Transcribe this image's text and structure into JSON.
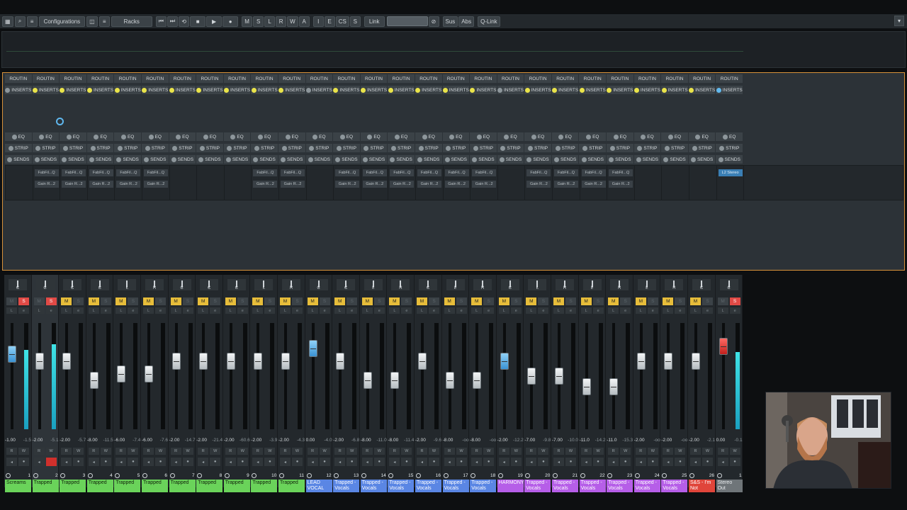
{
  "toolbar": {
    "configurations_label": "Configurations",
    "racks_label": "Racks",
    "transport_m": "M",
    "transport_s": "S",
    "transport_l": "L",
    "transport_r": "R",
    "transport_w": "W",
    "transport_a": "A",
    "transport_i": "I",
    "transport_e": "E",
    "transport_cs": "CS",
    "transport_s2": "S",
    "link_label": "Link",
    "sus_label": "Sus",
    "abs_label": "Abs",
    "qlink_label": "Q-Link"
  },
  "rack": {
    "routing_label": "ROUTIN",
    "inserts_label": "INSERTS",
    "eq_label": "EQ",
    "strip_label": "STRIP",
    "sends_label": "SENDS",
    "slot_fabfilter": "FabFil...Q",
    "slot_gain": "Gain R...2",
    "output_slot": "L2 Stereo"
  },
  "channels": [
    {
      "num": "1",
      "name": "Screams",
      "pan": "C",
      "m": false,
      "s": true,
      "fader": "-1.00",
      "peak": "-1.5",
      "color": "green",
      "meter": 0.75,
      "cap": 0.25,
      "capColor": "blue"
    },
    {
      "num": "2",
      "name": "Trapped",
      "pan": "C",
      "m": false,
      "s": true,
      "fader": "-2.00",
      "peak": "-5.1",
      "color": "green",
      "meter": 0.8,
      "cap": 0.32,
      "capColor": "white",
      "sel": true,
      "rec": true
    },
    {
      "num": "3",
      "name": "Trapped",
      "pan": "C",
      "m": true,
      "s": false,
      "fader": "-2.00",
      "peak": "-5.7",
      "color": "green",
      "meter": 0,
      "cap": 0.32,
      "capColor": "white"
    },
    {
      "num": "4",
      "name": "Trapped",
      "pan": "C",
      "m": true,
      "s": false,
      "fader": "-8.00",
      "peak": "-11.5",
      "color": "green",
      "meter": 0,
      "cap": 0.5,
      "capColor": "white"
    },
    {
      "num": "5",
      "name": "Trapped",
      "pan": "L",
      "m": true,
      "s": false,
      "fader": "-6.00",
      "peak": "-7.4",
      "color": "green",
      "meter": 0,
      "cap": 0.44,
      "capColor": "white"
    },
    {
      "num": "6",
      "name": "Trapped",
      "pan": "R",
      "m": true,
      "s": false,
      "fader": "-6.00",
      "peak": "-7.6",
      "color": "green",
      "meter": 0,
      "cap": 0.44,
      "capColor": "white"
    },
    {
      "num": "7",
      "name": "Trapped",
      "pan": "C",
      "m": true,
      "s": false,
      "fader": "-2.00",
      "peak": "-14.7",
      "color": "green",
      "meter": 0,
      "cap": 0.32,
      "capColor": "white"
    },
    {
      "num": "8",
      "name": "Trapped",
      "pan": "C",
      "m": true,
      "s": false,
      "fader": "-2.00",
      "peak": "-21.4",
      "color": "green",
      "meter": 0,
      "cap": 0.32,
      "capColor": "white"
    },
    {
      "num": "9",
      "name": "Trapped",
      "pan": "C",
      "m": true,
      "s": false,
      "fader": "-2.00",
      "peak": "-60.6",
      "color": "green",
      "meter": 0,
      "cap": 0.32,
      "capColor": "white"
    },
    {
      "num": "10",
      "name": "Trapped",
      "pan": "L",
      "m": true,
      "s": false,
      "fader": "-2.00",
      "peak": "-3.9",
      "color": "green",
      "meter": 0,
      "cap": 0.32,
      "capColor": "white"
    },
    {
      "num": "11",
      "name": "Trapped",
      "pan": "R",
      "m": true,
      "s": false,
      "fader": "-2.00",
      "peak": "-4.3",
      "color": "green",
      "meter": 0,
      "cap": 0.32,
      "capColor": "white"
    },
    {
      "num": "12",
      "name": "LEAD VOCAL",
      "pan": "C",
      "m": true,
      "s": false,
      "fader": "0.00",
      "peak": "-4.0",
      "color": "blue",
      "meter": 0,
      "cap": 0.2,
      "capColor": "blue"
    },
    {
      "num": "13",
      "name": "Trapped - Vocals",
      "pan": "C",
      "m": true,
      "s": false,
      "fader": "-2.00",
      "peak": "-6.8",
      "color": "blue",
      "meter": 0,
      "cap": 0.32,
      "capColor": "white"
    },
    {
      "num": "14",
      "name": "Trapped - Vocals",
      "pan": "L",
      "m": true,
      "s": false,
      "fader": "-8.00",
      "peak": "-11.0",
      "color": "blue",
      "meter": 0,
      "cap": 0.5,
      "capColor": "white"
    },
    {
      "num": "15",
      "name": "Trapped - Vocals",
      "pan": "R",
      "m": true,
      "s": false,
      "fader": "-8.00",
      "peak": "-11.4",
      "color": "blue",
      "meter": 0,
      "cap": 0.5,
      "capColor": "white"
    },
    {
      "num": "16",
      "name": "Trapped - Vocals",
      "pan": "C",
      "m": true,
      "s": false,
      "fader": "-2.00",
      "peak": "-9.6",
      "color": "blue",
      "meter": 0,
      "cap": 0.32,
      "capColor": "white"
    },
    {
      "num": "17",
      "name": "Trapped - Vocals",
      "pan": "L",
      "m": true,
      "s": false,
      "fader": "-8.00",
      "peak": "-oo",
      "color": "blue",
      "meter": 0,
      "cap": 0.5,
      "capColor": "white"
    },
    {
      "num": "18",
      "name": "Trapped - Vocals",
      "pan": "R",
      "m": true,
      "s": false,
      "fader": "-8.00",
      "peak": "-oo",
      "color": "blue",
      "meter": 0,
      "cap": 0.5,
      "capColor": "white"
    },
    {
      "num": "19",
      "name": "HARMONY",
      "pan": "C",
      "m": true,
      "s": false,
      "fader": "-2.00",
      "peak": "-12.2",
      "color": "purple",
      "meter": 0,
      "cap": 0.32,
      "capColor": "blue"
    },
    {
      "num": "20",
      "name": "Trapped - Vocals",
      "pan": "L",
      "m": true,
      "s": false,
      "fader": "-7.00",
      "peak": "-9.8",
      "color": "purple",
      "meter": 0,
      "cap": 0.46,
      "capColor": "white"
    },
    {
      "num": "21",
      "name": "Trapped - Vocals",
      "pan": "R",
      "m": true,
      "s": false,
      "fader": "-7.00",
      "peak": "-10.0",
      "color": "purple",
      "meter": 0,
      "cap": 0.46,
      "capColor": "white"
    },
    {
      "num": "22",
      "name": "Trapped - Vocals",
      "pan": "L",
      "m": true,
      "s": false,
      "fader": "-11.0",
      "peak": "-14.2",
      "color": "purple",
      "meter": 0,
      "cap": 0.56,
      "capColor": "white"
    },
    {
      "num": "23",
      "name": "Trapped - Vocals",
      "pan": "R",
      "m": true,
      "s": false,
      "fader": "-11.0",
      "peak": "-15.3",
      "color": "purple",
      "meter": 0,
      "cap": 0.56,
      "capColor": "white"
    },
    {
      "num": "24",
      "name": "Trapped - Vocals",
      "pan": "L",
      "m": true,
      "s": false,
      "fader": "-2.00",
      "peak": "-oo",
      "color": "purple",
      "meter": 0,
      "cap": 0.32,
      "capColor": "white"
    },
    {
      "num": "25",
      "name": "Trapped - Vocals",
      "pan": "R",
      "m": true,
      "s": false,
      "fader": "-2.00",
      "peak": "-oo",
      "color": "purple",
      "meter": 0,
      "cap": 0.32,
      "capColor": "white"
    },
    {
      "num": "26",
      "name": "S&S - I'm Not",
      "pan": "C",
      "m": true,
      "s": false,
      "fader": "-2.00",
      "peak": "-2.1",
      "color": "red",
      "meter": 0,
      "cap": 0.32,
      "capColor": "white"
    },
    {
      "num": "1",
      "name": "Stereo Out",
      "pan": "C",
      "m": false,
      "s": true,
      "fader": "0.00",
      "peak": "-0.1",
      "color": "grey",
      "meter": 0.73,
      "cap": 0.18,
      "capColor": "red"
    }
  ],
  "colors": {
    "accent_orange": "#d8923a",
    "mute_yellow": "#e7bd3a",
    "solo_red": "#e14a46",
    "play_green": "#37c04c",
    "cycle_purple": "#7a6fd6",
    "meter_cyan": "#3fe3e6"
  }
}
